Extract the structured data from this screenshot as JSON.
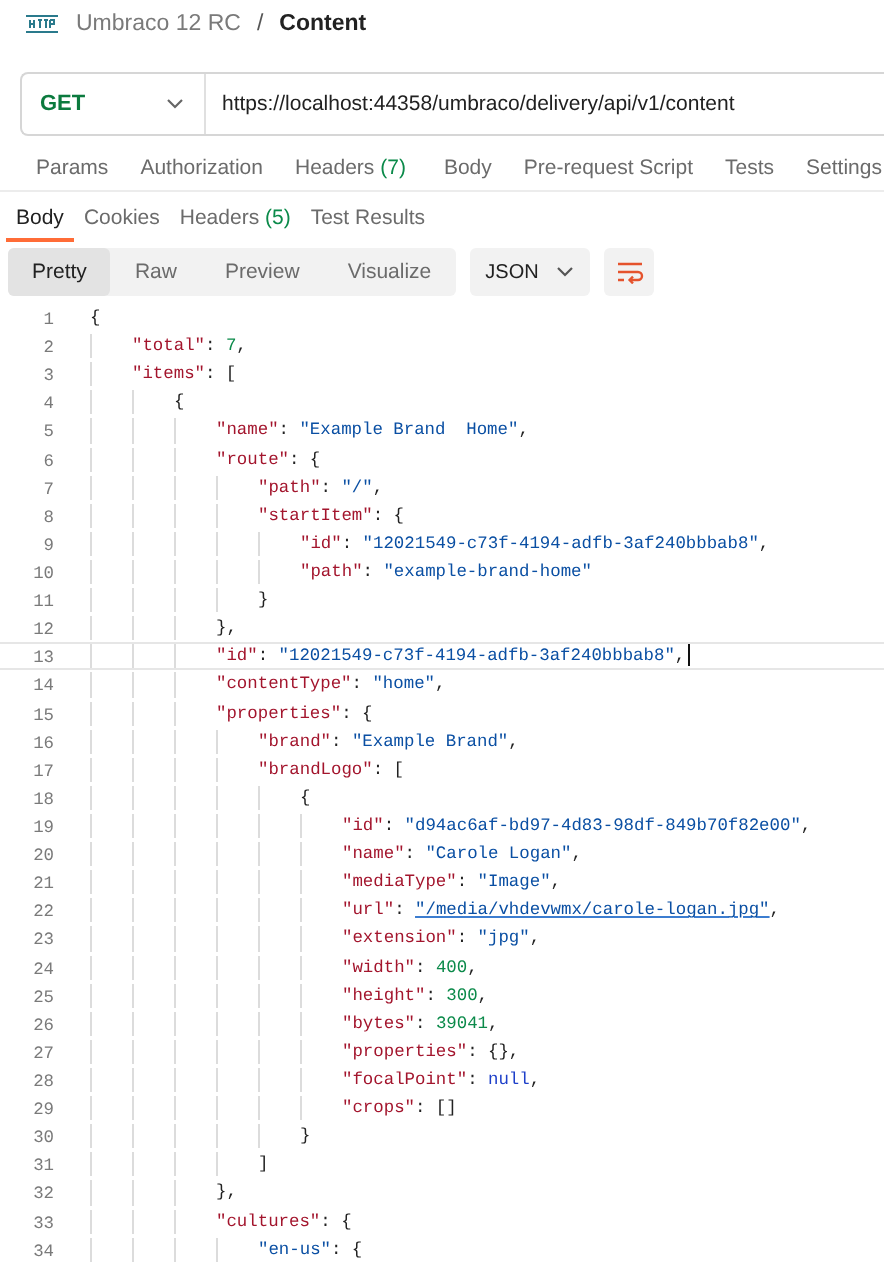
{
  "breadcrumb": {
    "collection": "Umbraco 12 RC",
    "separator": "/",
    "request": "Content"
  },
  "request": {
    "method": "GET",
    "url": "https://localhost:44358/umbraco/delivery/api/v1/content"
  },
  "request_tabs": [
    {
      "label": "Params",
      "selected": false
    },
    {
      "label": "Authorization",
      "selected": false
    },
    {
      "label": "Headers",
      "count": "(7)",
      "selected": false
    },
    {
      "label": "Body",
      "selected": false
    },
    {
      "label": "Pre-request Script",
      "selected": false
    },
    {
      "label": "Tests",
      "selected": false
    },
    {
      "label": "Settings",
      "selected": false
    }
  ],
  "response_tabs": [
    {
      "label": "Body",
      "selected": true
    },
    {
      "label": "Cookies",
      "selected": false
    },
    {
      "label": "Headers",
      "count": "(5)",
      "selected": false
    },
    {
      "label": "Test Results",
      "selected": false
    }
  ],
  "view_modes": [
    {
      "label": "Pretty",
      "selected": true
    },
    {
      "label": "Raw",
      "selected": false
    },
    {
      "label": "Preview",
      "selected": false
    },
    {
      "label": "Visualize",
      "selected": false
    }
  ],
  "format": "JSON",
  "code_lines": [
    {
      "number": "1",
      "current": false,
      "tokens": [
        {
          "kind": "punct",
          "text": "{"
        }
      ]
    },
    {
      "number": "2",
      "current": false,
      "tokens": [
        {
          "kind": "key",
          "text": "\"total\""
        },
        {
          "kind": "punct",
          "text": ": "
        },
        {
          "kind": "num",
          "text": "7"
        },
        {
          "kind": "punct",
          "text": ","
        }
      ]
    },
    {
      "number": "3",
      "current": false,
      "tokens": [
        {
          "kind": "key",
          "text": "\"items\""
        },
        {
          "kind": "punct",
          "text": ": ["
        }
      ]
    },
    {
      "number": "4",
      "current": false,
      "tokens": [
        {
          "kind": "punct",
          "text": "{"
        }
      ]
    },
    {
      "number": "5",
      "current": false,
      "tokens": [
        {
          "kind": "key",
          "text": "\"name\""
        },
        {
          "kind": "punct",
          "text": ": "
        },
        {
          "kind": "str",
          "text": "\"Example Brand  Home\""
        },
        {
          "kind": "punct",
          "text": ","
        }
      ]
    },
    {
      "number": "6",
      "current": false,
      "tokens": [
        {
          "kind": "key",
          "text": "\"route\""
        },
        {
          "kind": "punct",
          "text": ": {"
        }
      ]
    },
    {
      "number": "7",
      "current": false,
      "tokens": [
        {
          "kind": "key",
          "text": "\"path\""
        },
        {
          "kind": "punct",
          "text": ": "
        },
        {
          "kind": "str",
          "text": "\"/\""
        },
        {
          "kind": "punct",
          "text": ","
        }
      ]
    },
    {
      "number": "8",
      "current": false,
      "tokens": [
        {
          "kind": "key",
          "text": "\"startItem\""
        },
        {
          "kind": "punct",
          "text": ": {"
        }
      ]
    },
    {
      "number": "9",
      "current": false,
      "tokens": [
        {
          "kind": "key",
          "text": "\"id\""
        },
        {
          "kind": "punct",
          "text": ": "
        },
        {
          "kind": "str",
          "text": "\"12021549-c73f-4194-adfb-3af240bbbab8\""
        },
        {
          "kind": "punct",
          "text": ","
        }
      ]
    },
    {
      "number": "10",
      "current": false,
      "tokens": [
        {
          "kind": "key",
          "text": "\"path\""
        },
        {
          "kind": "punct",
          "text": ": "
        },
        {
          "kind": "str",
          "text": "\"example-brand-home\""
        }
      ]
    },
    {
      "number": "11",
      "current": false,
      "tokens": [
        {
          "kind": "punct",
          "text": "}"
        }
      ]
    },
    {
      "number": "12",
      "current": false,
      "tokens": [
        {
          "kind": "punct",
          "text": "},"
        }
      ]
    },
    {
      "number": "13",
      "current": true,
      "tokens": [
        {
          "kind": "key",
          "text": "\"id\""
        },
        {
          "kind": "punct",
          "text": ": "
        },
        {
          "kind": "str",
          "text": "\"12021549-c73f-4194-adfb-3af240bbbab8\""
        },
        {
          "kind": "punct",
          "text": ","
        }
      ]
    },
    {
      "number": "14",
      "current": false,
      "tokens": [
        {
          "kind": "key",
          "text": "\"contentType\""
        },
        {
          "kind": "punct",
          "text": ": "
        },
        {
          "kind": "str",
          "text": "\"home\""
        },
        {
          "kind": "punct",
          "text": ","
        }
      ]
    },
    {
      "number": "15",
      "current": false,
      "tokens": [
        {
          "kind": "key",
          "text": "\"properties\""
        },
        {
          "kind": "punct",
          "text": ": {"
        }
      ]
    },
    {
      "number": "16",
      "current": false,
      "tokens": [
        {
          "kind": "key",
          "text": "\"brand\""
        },
        {
          "kind": "punct",
          "text": ": "
        },
        {
          "kind": "str",
          "text": "\"Example Brand\""
        },
        {
          "kind": "punct",
          "text": ","
        }
      ]
    },
    {
      "number": "17",
      "current": false,
      "tokens": [
        {
          "kind": "key",
          "text": "\"brandLogo\""
        },
        {
          "kind": "punct",
          "text": ": ["
        }
      ]
    },
    {
      "number": "18",
      "current": false,
      "tokens": [
        {
          "kind": "punct",
          "text": "{"
        }
      ]
    },
    {
      "number": "19",
      "current": false,
      "tokens": [
        {
          "kind": "key",
          "text": "\"id\""
        },
        {
          "kind": "punct",
          "text": ": "
        },
        {
          "kind": "str",
          "text": "\"d94ac6af-bd97-4d83-98df-849b70f82e00\""
        },
        {
          "kind": "punct",
          "text": ","
        }
      ]
    },
    {
      "number": "20",
      "current": false,
      "tokens": [
        {
          "kind": "key",
          "text": "\"name\""
        },
        {
          "kind": "punct",
          "text": ": "
        },
        {
          "kind": "str",
          "text": "\"Carole Logan\""
        },
        {
          "kind": "punct",
          "text": ","
        }
      ]
    },
    {
      "number": "21",
      "current": false,
      "tokens": [
        {
          "kind": "key",
          "text": "\"mediaType\""
        },
        {
          "kind": "punct",
          "text": ": "
        },
        {
          "kind": "str",
          "text": "\"Image\""
        },
        {
          "kind": "punct",
          "text": ","
        }
      ]
    },
    {
      "number": "22",
      "current": false,
      "tokens": [
        {
          "kind": "key",
          "text": "\"url\""
        },
        {
          "kind": "punct",
          "text": ": "
        },
        {
          "kind": "link",
          "text": "\"/media/vhdevwmx/carole-logan.jpg\""
        },
        {
          "kind": "punct",
          "text": ","
        }
      ]
    },
    {
      "number": "23",
      "current": false,
      "tokens": [
        {
          "kind": "key",
          "text": "\"extension\""
        },
        {
          "kind": "punct",
          "text": ": "
        },
        {
          "kind": "str",
          "text": "\"jpg\""
        },
        {
          "kind": "punct",
          "text": ","
        }
      ]
    },
    {
      "number": "24",
      "current": false,
      "tokens": [
        {
          "kind": "key",
          "text": "\"width\""
        },
        {
          "kind": "punct",
          "text": ": "
        },
        {
          "kind": "num",
          "text": "400"
        },
        {
          "kind": "punct",
          "text": ","
        }
      ]
    },
    {
      "number": "25",
      "current": false,
      "tokens": [
        {
          "kind": "key",
          "text": "\"height\""
        },
        {
          "kind": "punct",
          "text": ": "
        },
        {
          "kind": "num",
          "text": "300"
        },
        {
          "kind": "punct",
          "text": ","
        }
      ]
    },
    {
      "number": "26",
      "current": false,
      "tokens": [
        {
          "kind": "key",
          "text": "\"bytes\""
        },
        {
          "kind": "punct",
          "text": ": "
        },
        {
          "kind": "num",
          "text": "39041"
        },
        {
          "kind": "punct",
          "text": ","
        }
      ]
    },
    {
      "number": "27",
      "current": false,
      "tokens": [
        {
          "kind": "key",
          "text": "\"properties\""
        },
        {
          "kind": "punct",
          "text": ": {},"
        }
      ]
    },
    {
      "number": "28",
      "current": false,
      "tokens": [
        {
          "kind": "key",
          "text": "\"focalPoint\""
        },
        {
          "kind": "punct",
          "text": ": "
        },
        {
          "kind": "lit",
          "text": "null"
        },
        {
          "kind": "punct",
          "text": ","
        }
      ]
    },
    {
      "number": "29",
      "current": false,
      "tokens": [
        {
          "kind": "key",
          "text": "\"crops\""
        },
        {
          "kind": "punct",
          "text": ": []"
        }
      ]
    },
    {
      "number": "30",
      "current": false,
      "tokens": [
        {
          "kind": "punct",
          "text": "}"
        }
      ]
    },
    {
      "number": "31",
      "current": false,
      "tokens": [
        {
          "kind": "punct",
          "text": "]"
        }
      ]
    },
    {
      "number": "32",
      "current": false,
      "tokens": [
        {
          "kind": "punct",
          "text": "},"
        }
      ]
    },
    {
      "number": "33",
      "current": false,
      "tokens": [
        {
          "kind": "key",
          "text": "\"cultures\""
        },
        {
          "kind": "punct",
          "text": ": {"
        }
      ]
    },
    {
      "number": "34",
      "current": false,
      "tokens": [
        {
          "kind": "str",
          "text": "\"en-us\""
        },
        {
          "kind": "punct",
          "text": ": {"
        }
      ]
    }
  ]
}
